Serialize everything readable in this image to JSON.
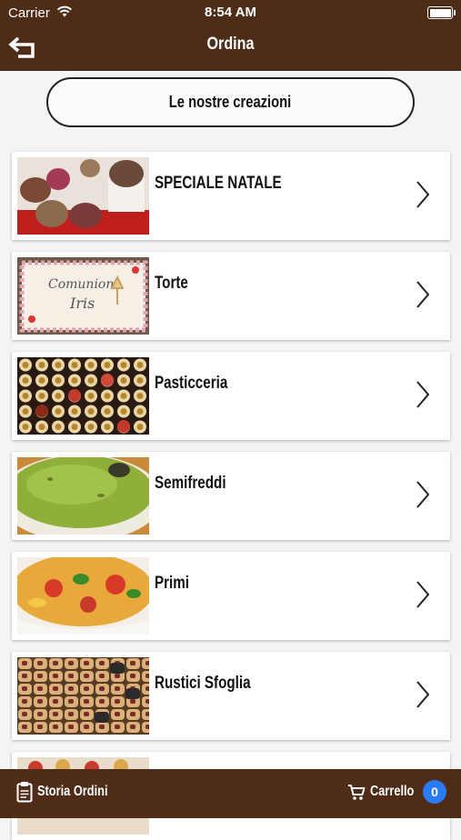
{
  "status_bar": {
    "carrier": "Carrier",
    "time": "8:54 AM"
  },
  "header": {
    "title": "Ordina"
  },
  "pill_button": {
    "label": "Le nostre creazioni"
  },
  "categories": [
    {
      "label": "SPECIALE NATALE",
      "image": "christmas-panettoni-photo"
    },
    {
      "label": "Torte",
      "image": "cake-photo"
    },
    {
      "label": "Pasticceria",
      "image": "pastries-tray-photo"
    },
    {
      "label": "Semifreddi",
      "image": "pistachio-semifreddo-photo"
    },
    {
      "label": "Primi",
      "image": "pasta-dish-photo"
    },
    {
      "label": "Rustici Sfoglia",
      "image": "puff-pastry-snacks-photo"
    }
  ],
  "tab_bar": {
    "orders_label": "Storia Ordini",
    "cart_label": "Carrello",
    "cart_count": "0"
  },
  "colors": {
    "brand_brown": "#4e2c17",
    "badge_blue": "#2a7bf6",
    "background": "#f4f4f4"
  }
}
